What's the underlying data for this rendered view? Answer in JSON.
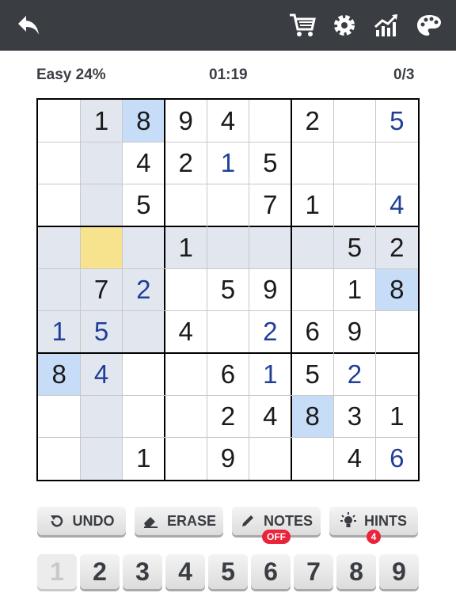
{
  "header": {
    "icons": [
      "back-arrow-icon",
      "cart-icon",
      "gear-icon",
      "stats-chart-icon",
      "palette-icon"
    ]
  },
  "status": {
    "difficulty": "Easy 24%",
    "timer": "01:19",
    "mistakes": "0/3"
  },
  "colors": {
    "topbar": "#3a3d42",
    "row_col_highlight": "#e2e7ef",
    "same_number": "#c6dcf7",
    "selected": "#f7e38e",
    "given": "#1a1a1a",
    "user": "#1f3f99"
  },
  "board": {
    "values": [
      [
        "",
        "1",
        "8",
        "9",
        "4",
        "",
        "2",
        "",
        "5"
      ],
      [
        "",
        "",
        "4",
        "2",
        "1",
        "5",
        "",
        "",
        ""
      ],
      [
        "",
        "",
        "5",
        "",
        "",
        "7",
        "1",
        "",
        "4"
      ],
      [
        "",
        "",
        "",
        "1",
        "",
        "",
        "",
        "5",
        "2"
      ],
      [
        "",
        "7",
        "2",
        "",
        "5",
        "9",
        "",
        "1",
        "8"
      ],
      [
        "1",
        "5",
        "",
        "4",
        "",
        "2",
        "6",
        "9",
        ""
      ],
      [
        "8",
        "4",
        "",
        "",
        "6",
        "1",
        "5",
        "2",
        ""
      ],
      [
        "",
        "",
        "",
        "",
        "2",
        "4",
        "8",
        "3",
        "1"
      ],
      [
        "",
        "",
        "1",
        "",
        "9",
        "",
        "",
        "4",
        "6"
      ]
    ],
    "user_entered": [
      [
        0,
        8
      ],
      [
        1,
        4
      ],
      [
        2,
        8
      ],
      [
        4,
        2
      ],
      [
        5,
        0
      ],
      [
        5,
        1
      ],
      [
        5,
        5
      ],
      [
        6,
        1
      ],
      [
        6,
        5
      ],
      [
        6,
        7
      ],
      [
        8,
        8
      ]
    ],
    "same_number_cells": [
      [
        0,
        2
      ],
      [
        4,
        8
      ],
      [
        6,
        0
      ],
      [
        7,
        6
      ]
    ],
    "selected_cell": [
      3,
      1
    ]
  },
  "controls": {
    "undo": "UNDO",
    "erase": "ERASE",
    "notes": "NOTES",
    "notes_badge": "OFF",
    "hints": "HINTS",
    "hints_badge": "4"
  },
  "numpad": [
    "1",
    "2",
    "3",
    "4",
    "5",
    "6",
    "7",
    "8",
    "9"
  ],
  "numpad_disabled": [
    "1"
  ]
}
